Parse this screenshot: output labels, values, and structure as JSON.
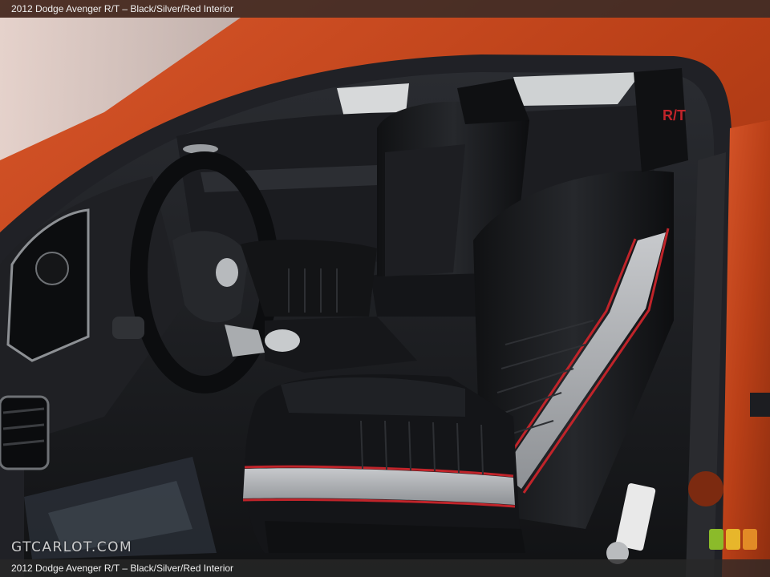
{
  "caption": {
    "top": "2012 Dodge Avenger R/T – Black/Silver/Red Interior",
    "bottom": "2012 Dodge Avenger R/T – Black/Silver/Red Interior"
  },
  "watermark": {
    "text": "GTCARLOT.COM"
  },
  "headrest_logo": "R/T",
  "colors": {
    "body_paint": "#c4461a",
    "seat_black": "#17181b",
    "seat_silver": "#a9acb0",
    "stripe_red": "#c0242a",
    "logo_green": "#8bbb2a",
    "logo_yellow": "#e7b62b",
    "logo_orange": "#e28b26"
  }
}
